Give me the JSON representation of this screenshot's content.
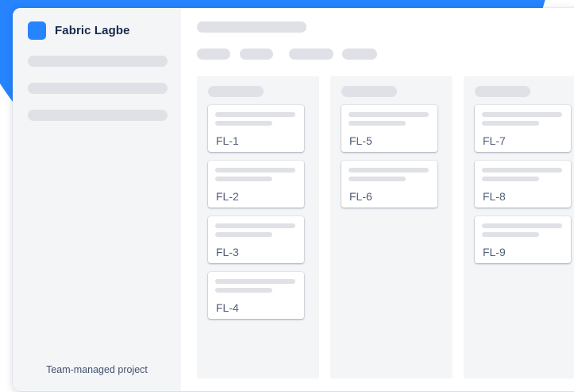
{
  "colors": {
    "accent_blue": "#2684ff",
    "brand_icon": "#2684ff",
    "sidebar_bg": "#f4f5f7",
    "placeholder": "#dfe1e6"
  },
  "project": {
    "name": "Fabric Lagbe",
    "icon": "project-square-icon",
    "footer": "Team-managed project"
  },
  "board": {
    "columns": [
      {
        "cards": [
          {
            "key": "FL-1"
          },
          {
            "key": "FL-2"
          },
          {
            "key": "FL-3"
          },
          {
            "key": "FL-4"
          }
        ]
      },
      {
        "cards": [
          {
            "key": "FL-5"
          },
          {
            "key": "FL-6"
          }
        ]
      },
      {
        "cards": [
          {
            "key": "FL-7"
          },
          {
            "key": "FL-8"
          },
          {
            "key": "FL-9"
          }
        ]
      }
    ]
  }
}
